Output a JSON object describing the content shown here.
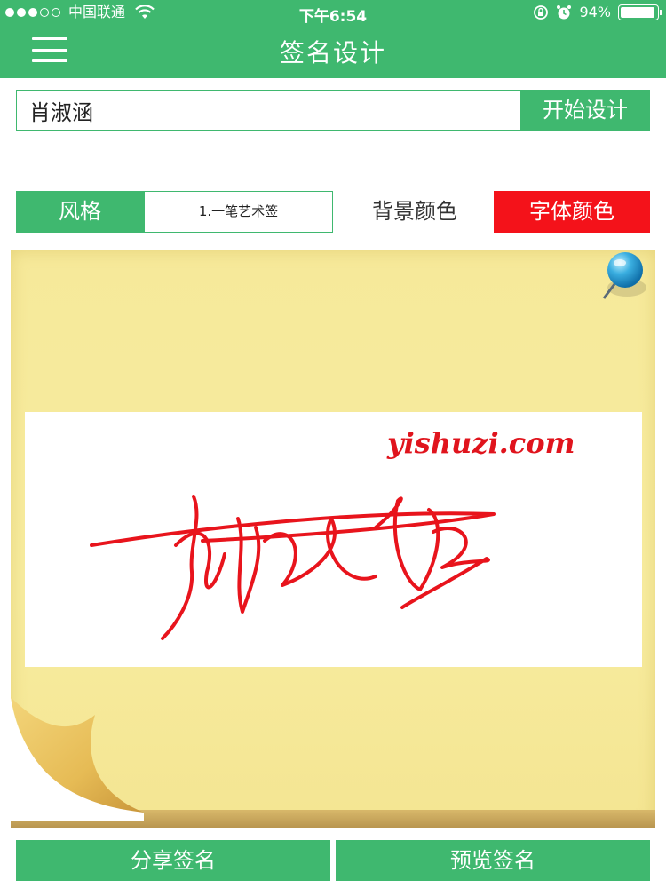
{
  "status_bar": {
    "carrier": "中国联通",
    "time": "下午6:54",
    "battery": "94%",
    "battery_level": 0.94
  },
  "nav": {
    "title": "签名设计",
    "menu_icon": "hamburger-menu-icon"
  },
  "form": {
    "name_value": "肖淑涵",
    "start_button": "开始设计"
  },
  "style": {
    "label": "风格",
    "selected": "1.一笔艺术签",
    "bg_color_label": "背景颜色",
    "font_color_label": "字体颜色"
  },
  "signature": {
    "watermark": "yishuzi.com",
    "ink_color": "#e8141c"
  },
  "actions": {
    "share": "分享签名",
    "preview": "预览签名"
  },
  "colors": {
    "accent": "#3fb86f",
    "font_color_swatch": "#f4121a"
  }
}
